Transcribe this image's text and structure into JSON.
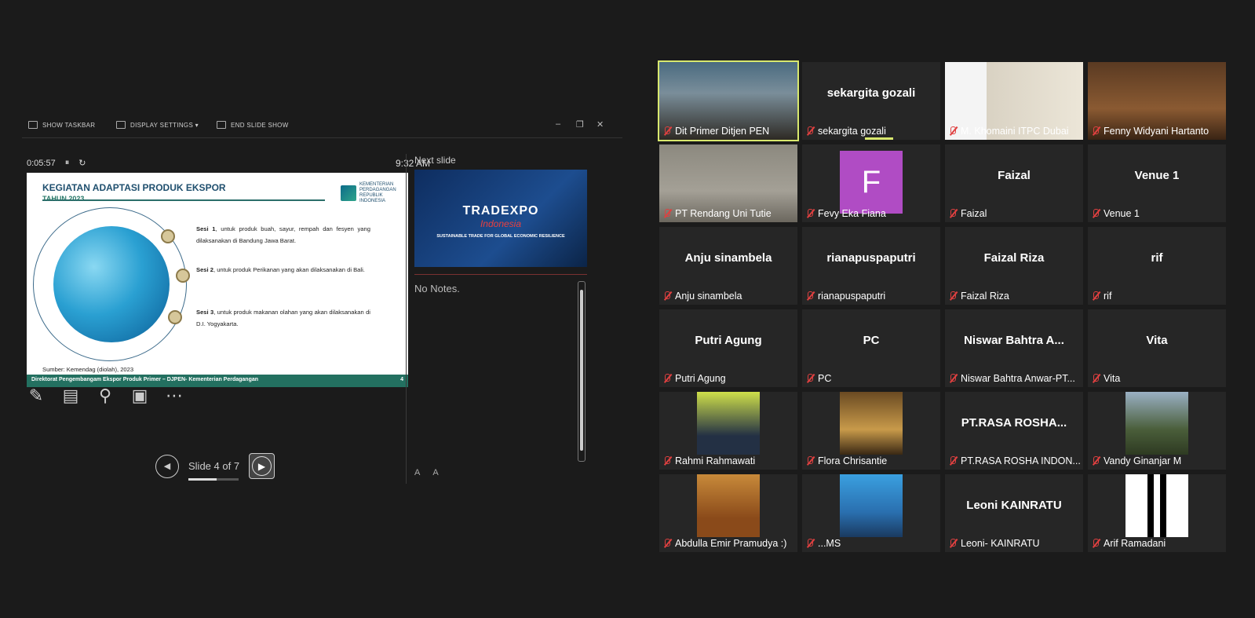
{
  "toolbar": {
    "show_taskbar": "SHOW TASKBAR",
    "display_settings": "DISPLAY SETTINGS ▾",
    "end_slide_show": "END SLIDE SHOW",
    "minimize": "–",
    "restore": "❐",
    "close": "✕"
  },
  "presenter": {
    "timer": "0:05:57",
    "pause_icon": "⏸",
    "reset_icon": "↻",
    "clock": "9:32 AM",
    "slide_counter": "Slide 4 of 7",
    "slide_progress": 0.57,
    "next_slide_label": "Next slide",
    "notes": "No Notes.",
    "font_larger": "A",
    "font_smaller": "A"
  },
  "slide": {
    "title": "KEGIATAN ADAPTASI PRODUK EKSPOR",
    "subtitle": "TAHUN 2023",
    "logo_text": "KEMENTERIAN PERDAGANGAN REPUBLIK INDONESIA",
    "sesi1_bold": "Sesi 1",
    "sesi1_text": ", untuk produk buah, sayur, rempah dan fesyen yang dilaksanakan di Bandung Jawa Barat.",
    "sesi2_bold": "Sesi 2",
    "sesi2_text": ", untuk produk Perikanan yang akan dilaksanakan di Bali.",
    "sesi3_bold": "Sesi 3",
    "sesi3_text": ", untuk produk makanan olahan yang akan dilaksanakan di D.I. Yogyakarta.",
    "source": "Sumber: Kemendag (diolah), 2023",
    "footer": "Direktorat Pengembangam Ekspor Produk Primer – DJPEN- Kementerian Perdagangan",
    "page": "4"
  },
  "next_slide": {
    "brand": "TRADEXPO",
    "brand_sub": "Indonesia",
    "tagline": "SUSTAINABLE TRADE FOR GLOBAL ECONOMIC RESILIENCE"
  },
  "participants": [
    {
      "display": "",
      "name": "Dit Primer Ditjen PEN",
      "type": "video-room",
      "active": true
    },
    {
      "display": "sekargita gozali",
      "name": "sekargita gozali",
      "type": "text",
      "speaking": true
    },
    {
      "display": "",
      "name": "M. Khomaini ITPC Dubai",
      "type": "video-slide"
    },
    {
      "display": "",
      "name": "Fenny Widyani Hartanto",
      "type": "video-avatar"
    },
    {
      "display": "",
      "name": "PT Rendang Uni Tutie",
      "type": "video-blur"
    },
    {
      "display": "F",
      "name": "Fevy Eka Fiana",
      "type": "letter"
    },
    {
      "display": "Faizal",
      "name": "Faizal",
      "type": "text"
    },
    {
      "display": "Venue 1",
      "name": "Venue 1",
      "type": "text"
    },
    {
      "display": "Anju sinambela",
      "name": "Anju sinambela",
      "type": "text"
    },
    {
      "display": "rianapuspaputri",
      "name": "rianapuspaputri",
      "type": "text"
    },
    {
      "display": "Faizal Riza",
      "name": "Faizal Riza",
      "type": "text"
    },
    {
      "display": "rif",
      "name": "rif",
      "type": "text"
    },
    {
      "display": "Putri Agung",
      "name": "Putri Agung",
      "type": "text"
    },
    {
      "display": "PC",
      "name": "PC",
      "type": "text"
    },
    {
      "display": "Niswar Bahtra A...",
      "name": "Niswar Bahtra Anwar-PT...",
      "type": "text"
    },
    {
      "display": "Vita",
      "name": "Vita",
      "type": "text"
    },
    {
      "display": "",
      "name": "Rahmi Rahmawati",
      "type": "photo-hijab"
    },
    {
      "display": "",
      "name": "Flora Chrisantie",
      "type": "photo-gold"
    },
    {
      "display": "PT.RASA  ROSHA...",
      "name": "PT.RASA ROSHA INDON...",
      "type": "text"
    },
    {
      "display": "",
      "name": "Vandy Ginanjar M",
      "type": "photo-outdoor"
    },
    {
      "display": "",
      "name": "Abdulla Emir Pramudya :)",
      "type": "photo-warm"
    },
    {
      "display": "",
      "name": "...MS",
      "type": "photo-blue"
    },
    {
      "display": "Leoni  KAINRATU",
      "name": "Leoni- KAINRATU",
      "type": "text"
    },
    {
      "display": "",
      "name": "Arif Ramadani",
      "type": "photo-logo"
    }
  ],
  "colors": {
    "active_speaker": "#d8e86e",
    "muted": "#e04040",
    "slide_accent": "#237060"
  }
}
